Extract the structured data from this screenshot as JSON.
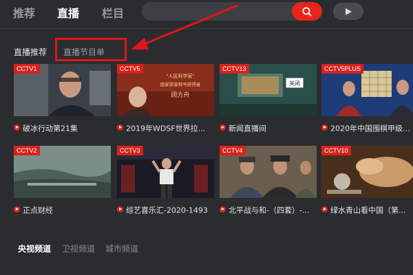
{
  "nav": {
    "tabs": [
      {
        "label": "推荐"
      },
      {
        "label": "直播"
      },
      {
        "label": "栏目"
      }
    ],
    "search": {
      "placeholder": ""
    },
    "accent": "#e8241a"
  },
  "subtabs": {
    "live_recommend": "直播推荐",
    "program_list": "直播节目单"
  },
  "cards": [
    {
      "channel": "CCTV1",
      "title": "破冰行动第21集"
    },
    {
      "channel": "CCTV5",
      "title": "2019年WDSF世界拉..."
    },
    {
      "channel": "CCTV13",
      "title": "新闻直播间"
    },
    {
      "channel": "CCTV5PLUS",
      "title": "2020年中国围棋甲级..."
    },
    {
      "channel": "CCTV2",
      "title": "正点财经"
    },
    {
      "channel": "CCTV3",
      "title": "综艺喜乐汇-2020-1493"
    },
    {
      "channel": "CCTV4",
      "title": "北平战与和-（四套）-..."
    },
    {
      "channel": "CCTV10",
      "title": "绿水青山看中国（第..."
    }
  ],
  "thumb_text": {
    "cctv5_l1": "\"人民科学家\"",
    "cctv5_l2": "国家荣誉称号获得者",
    "cctv5_l3": "顾方舟",
    "cctv13_close": "关闭"
  },
  "channels": {
    "cctv": "央视频道",
    "satellite": "卫视频道",
    "city": "城市频道"
  }
}
